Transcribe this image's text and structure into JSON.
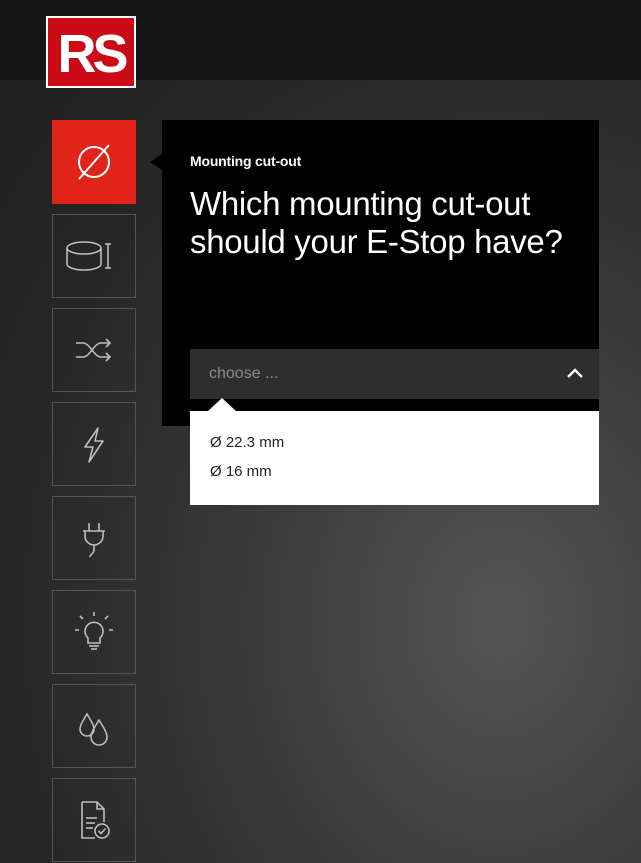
{
  "brand": {
    "logo_text": "RS",
    "logo_color": "#cc0a16"
  },
  "sidebar": {
    "items": [
      {
        "icon": "diameter-icon",
        "active": true
      },
      {
        "icon": "cylinder-height-icon",
        "active": false
      },
      {
        "icon": "shuffle-arrows-icon",
        "active": false
      },
      {
        "icon": "lightning-icon",
        "active": false
      },
      {
        "icon": "plug-icon",
        "active": false
      },
      {
        "icon": "lightbulb-icon",
        "active": false
      },
      {
        "icon": "water-drops-icon",
        "active": false
      },
      {
        "icon": "document-check-icon",
        "active": false
      }
    ],
    "active_color": "#e2231a"
  },
  "question": {
    "kicker": "Mounting cut-out",
    "text": "Which mounting cut-out should your E-Stop have?"
  },
  "select": {
    "placeholder": "choose ...",
    "options": [
      "Ø 22.3 mm",
      "Ø 16 mm"
    ]
  }
}
